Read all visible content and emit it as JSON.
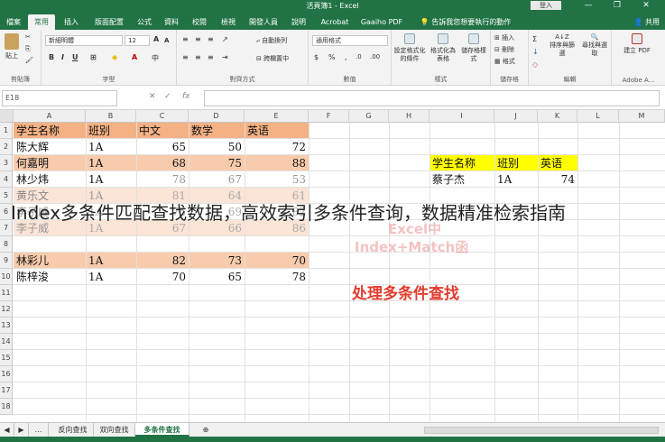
{
  "window": {
    "title": "活頁簿1 - Excel",
    "signin": "登入",
    "share": "共用",
    "tell_me": "告訴我您想要執行的動作",
    "min": "—",
    "restore": "❐",
    "close": "✕"
  },
  "ribbon_tabs": [
    "檔案",
    "常用",
    "插入",
    "版面配置",
    "公式",
    "資料",
    "校閱",
    "檢視",
    "開發人員",
    "說明",
    "Acrobat",
    "Gaaiho PDF"
  ],
  "ribbon": {
    "clipboard_label": "剪貼簿",
    "paste_label": "貼上",
    "font_label": "字型",
    "font_name": "新細明體",
    "font_size": "12",
    "align_label": "對齊方式",
    "wrap": "自動換列",
    "merge": "跨欄置中",
    "number_label": "數值",
    "number_format": "通用格式",
    "styles_label": "樣式",
    "cond_format": "設定格式化的條件",
    "table_format": "格式化為表格",
    "cell_styles": "儲存格樣式",
    "cells_label": "儲存格",
    "insert": "插入",
    "delete": "刪除",
    "format": "格式",
    "edit_label": "編輯",
    "sort": "排序與篩選",
    "find": "尋找與選取",
    "adobe_label": "Adobe A...",
    "create_pdf": "建立 PDF"
  },
  "formula_bar": {
    "name_box": "E18",
    "fx": "fx"
  },
  "columns": [
    "A",
    "B",
    "C",
    "D",
    "E",
    "F",
    "G",
    "H",
    "I",
    "J",
    "K",
    "L",
    "M"
  ],
  "rows": [
    "1",
    "2",
    "3",
    "4",
    "5",
    "6",
    "7",
    "8",
    "9",
    "10",
    "11",
    "12",
    "13",
    "14",
    "15",
    "16",
    "17",
    "18"
  ],
  "table": {
    "headers": [
      "学生名称",
      "班别",
      "中文",
      "数学",
      "英语"
    ],
    "data": [
      [
        "陈大辉",
        "1A",
        "65",
        "50",
        "72"
      ],
      [
        "何嘉明",
        "1A",
        "68",
        "75",
        "88"
      ],
      [
        "林少炜",
        "1A",
        "78",
        "67",
        "53"
      ],
      [
        "黄乐文",
        "1A",
        "81",
        "64",
        "61"
      ],
      [
        "李子威",
        "1A",
        "75",
        "69",
        "82"
      ],
      [
        "李子威",
        "1A",
        "67",
        "66",
        "86"
      ],
      [
        "林彩儿",
        "1A",
        "82",
        "73",
        "70"
      ],
      [
        "陈梓浚",
        "1A",
        "70",
        "65",
        "78"
      ]
    ]
  },
  "lookup": {
    "headers": [
      "学生名称",
      "班别",
      "英语"
    ],
    "row": [
      "蔡子杰",
      "1A",
      "74"
    ]
  },
  "overlay": {
    "caption": "Index多条件匹配查找数据，高效索引多条件查询，数据精准检索指南",
    "wm_line1": "Excel中",
    "wm_line2": "Index+Match函",
    "red_title": "处理多条件查找"
  },
  "sheet_tabs": [
    "反向查找",
    "双向查找",
    "多条件查找"
  ],
  "colors": {
    "excel_green": "#217346",
    "header_band": "#f4b183",
    "light_band": "#fce4d6",
    "yellow": "#ffff00",
    "red": "#e23b2e"
  }
}
